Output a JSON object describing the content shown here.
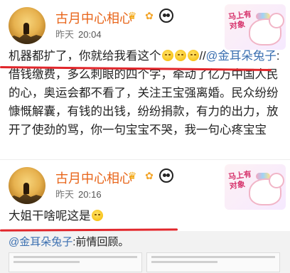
{
  "posts": [
    {
      "author": "古月中心相心",
      "meta_prefix": "昨天",
      "time": "20:04",
      "sticker_text": "马上有对象",
      "content": {
        "lead": "机器都扩了，你就给我看这个",
        "sep": "//",
        "mention": "@金耳朵兔子",
        "rest": ":借钱缴费，多么刺眼的四个字，牵动了亿万中国人民的心，奥运会都不看了，关注王宝强离婚。民众纷纷慷慨解囊，有钱的出钱，纷纷捐款，有力的出力，放开了使劲的骂，你一句宝宝不哭，我一句心疼宝宝"
      }
    },
    {
      "author": "古月中心相心",
      "meta_prefix": "昨天",
      "time": "20:16",
      "sticker_text": "马上有对象",
      "content": {
        "lead": "大姐干啥呢这是"
      },
      "quote": {
        "mention": "@金耳朵兔子",
        "text": ":前情回顾。"
      }
    }
  ],
  "icons": {
    "badge1": "crown-icon",
    "badge2": "flower-icon",
    "badge3": "panda-icon"
  },
  "colors": {
    "author": "#e8651a",
    "mention": "#3a6fb0",
    "underline": "#e1262b"
  }
}
